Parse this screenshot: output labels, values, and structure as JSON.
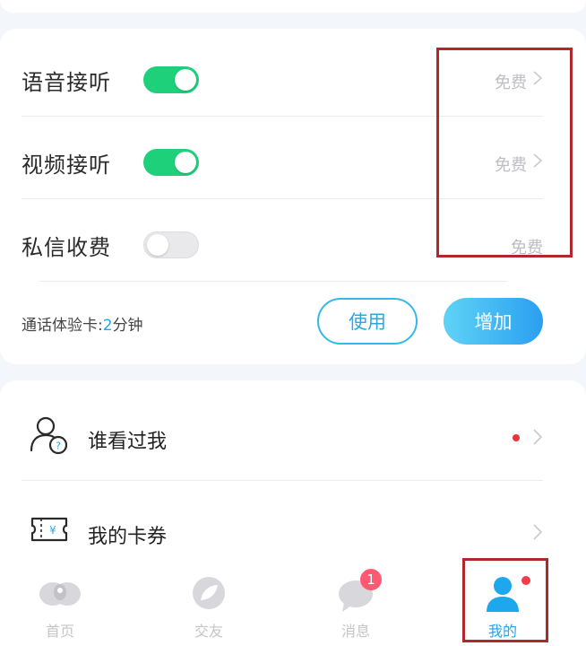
{
  "settings": {
    "voice": {
      "label": "语音接听",
      "price": "免费",
      "enabled": true
    },
    "video": {
      "label": "视频接听",
      "price": "免费",
      "enabled": true
    },
    "message": {
      "label": "私信收费",
      "price": "免费",
      "enabled": false
    }
  },
  "trial": {
    "prefix": "通话体验卡:",
    "value": "2",
    "suffix": "分钟",
    "use_label": "使用",
    "add_label": "增加"
  },
  "menu": [
    {
      "label": "谁看过我",
      "icon": "visitor-icon",
      "has_dot": true
    },
    {
      "label": "我的卡券",
      "icon": "coupon-icon",
      "has_dot": false
    }
  ],
  "tabs": [
    {
      "label": "首页",
      "icon": "home-icon"
    },
    {
      "label": "交友",
      "icon": "friends-icon"
    },
    {
      "label": "消息",
      "icon": "message-icon",
      "badge": "1"
    },
    {
      "label": "我的",
      "icon": "profile-icon",
      "active": true
    }
  ],
  "colors": {
    "accent": "#1ea7ec",
    "toggle_on": "#1ed07a",
    "badge": "#ff5a72",
    "highlight": "#b0282c"
  }
}
